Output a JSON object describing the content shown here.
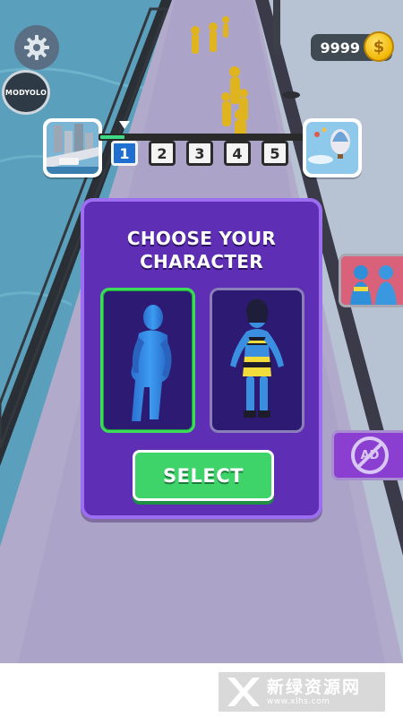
{
  "hud": {
    "settings_icon": "gear-icon",
    "badge_label": "MODYOLO",
    "coin_count": "9999",
    "coin_icon": "coin-icon",
    "coin_symbol": "$"
  },
  "level_progress": {
    "stages": [
      "1",
      "2",
      "3",
      "4",
      "5"
    ],
    "current_stage": "1",
    "fill_fraction": 0.12
  },
  "character_select": {
    "title_line1": "CHOOSE YOUR",
    "title_line2": "CHARACTER",
    "options": [
      "male-character",
      "female-character"
    ],
    "selected_option": "male-character",
    "select_label": "SELECT"
  },
  "side_buttons": {
    "skins_icon": "characters-icon",
    "no_ads_icon": "no-ads-icon",
    "no_ads_text": "AD"
  },
  "watermark": {
    "cn_text": "新绿资源网",
    "url_text": "www.xlhs.com"
  },
  "colors": {
    "panel": "#5e2fb4",
    "panel_border": "#9b6ff0",
    "select_button": "#3ed46a",
    "selected_border": "#3edb5a",
    "current_stage": "#1f6fd1",
    "coin": "#f2b705"
  }
}
